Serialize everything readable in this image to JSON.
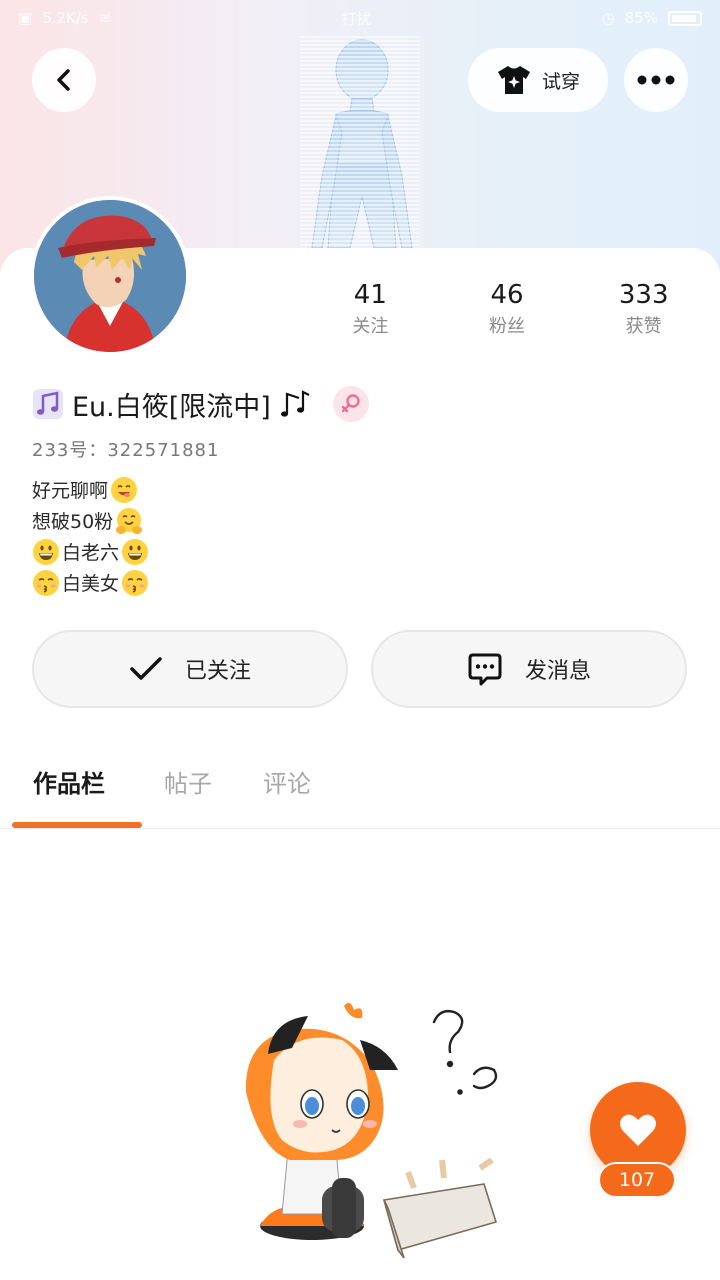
{
  "status_bar": {
    "left_text": "5.2K/s",
    "center_text": "打扰",
    "battery_text": "85%"
  },
  "header": {
    "try_on_label": "试穿",
    "back_icon": "chevron-left-icon",
    "more_icon": "more-horizontal-icon",
    "try_on_icon": "shirt-sparkle-icon"
  },
  "profile": {
    "stats": [
      {
        "value": "41",
        "label": "关注"
      },
      {
        "value": "46",
        "label": "粉丝"
      },
      {
        "value": "333",
        "label": "获赞"
      }
    ],
    "username": "Eu.白筱[限流中]",
    "username_prefix_icon": "music-note-icon",
    "username_suffix_icon": "music-notes-icon",
    "gender_icon": "female-icon",
    "uid": "233号：322571881",
    "bio": [
      {
        "text": "好元聊啊",
        "emoji_after": "yum-face"
      },
      {
        "text": "想破50粉",
        "emoji_after": "hugging-face"
      },
      {
        "emoji_before": "grinning-face",
        "text": "白老六",
        "emoji_after": "grinning-face"
      },
      {
        "emoji_before": "kissing-face",
        "text": "白美女",
        "emoji_after": "kissing-face"
      }
    ]
  },
  "actions": {
    "follow_label": "已关注",
    "message_label": "发消息"
  },
  "tabs": [
    {
      "label": "作品栏",
      "active": true
    },
    {
      "label": "帖子",
      "active": false
    },
    {
      "label": "评论",
      "active": false
    }
  ],
  "like": {
    "count": "107"
  },
  "colors": {
    "accent": "#f56a1a",
    "tab_underline": "#f07127",
    "gender_badge_bg": "#fde3ea"
  }
}
